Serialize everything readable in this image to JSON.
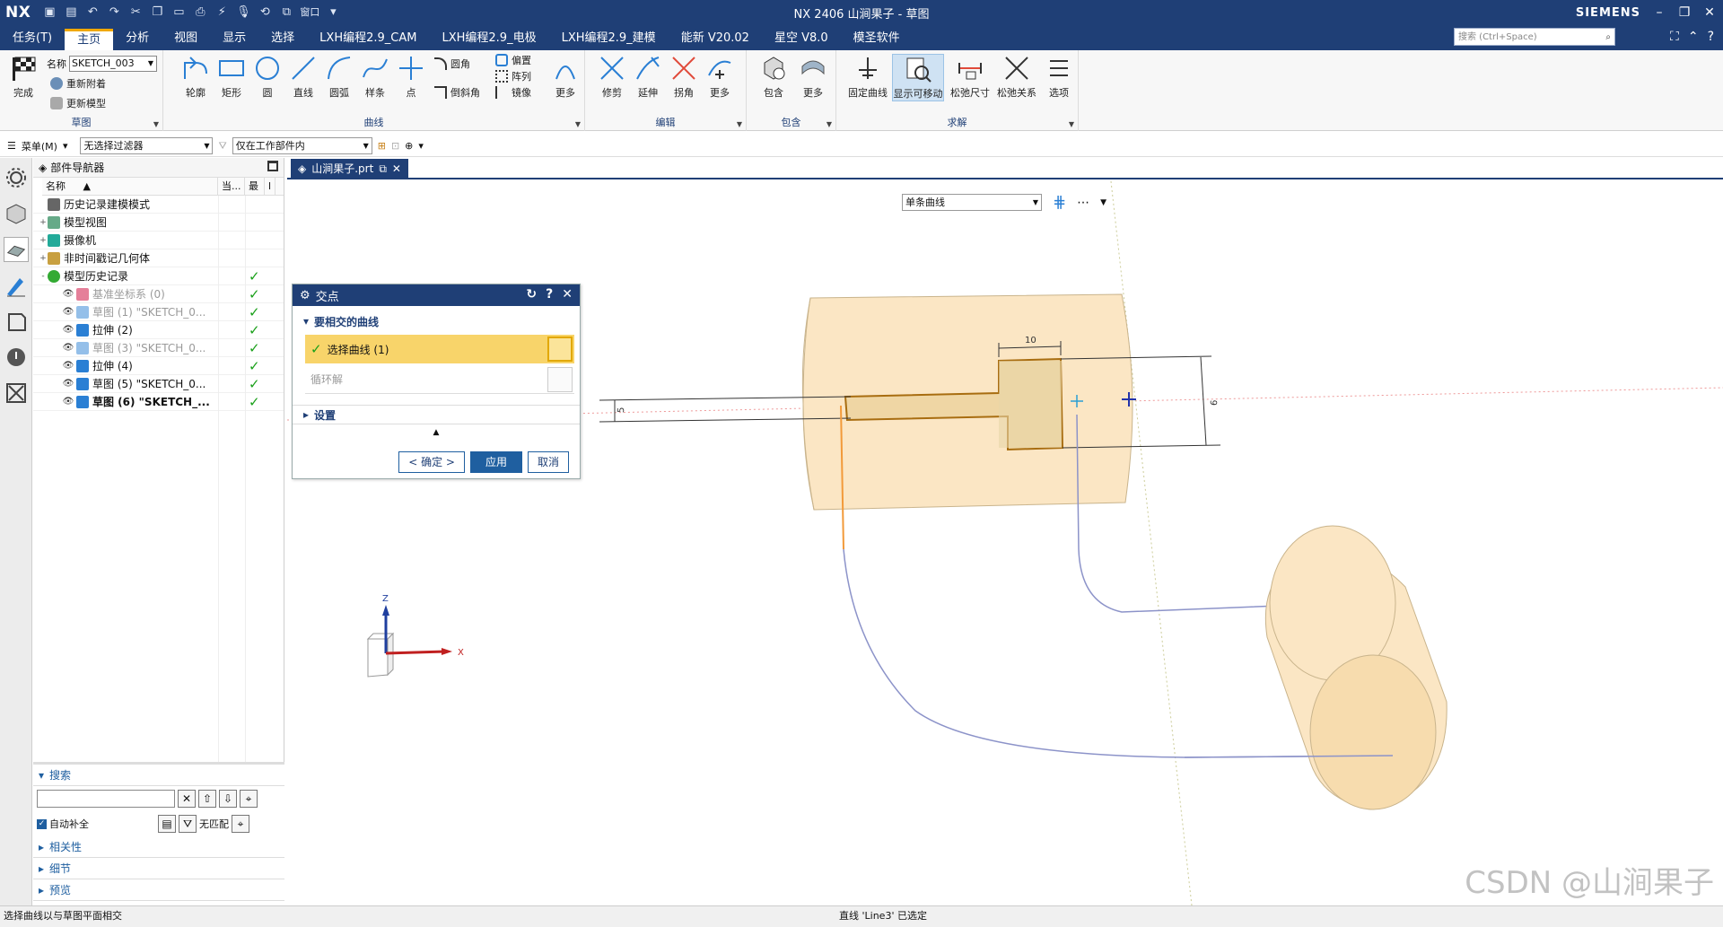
{
  "titlebar": {
    "logo": "NX",
    "title": "NX 2406 山涧果子 - 草图",
    "brand": "SIEMENS",
    "window_label": "窗口"
  },
  "menu": {
    "tabs": [
      "任务(T)",
      "主页",
      "分析",
      "视图",
      "显示",
      "选择",
      "LXH编程2.9_CAM",
      "LXH编程2.9_电极",
      "LXH编程2.9_建模",
      "能新 V20.02",
      "星空 V8.0",
      "模圣软件"
    ],
    "active_index": 1,
    "search_placeholder": "搜索 (Ctrl+Space)"
  },
  "ribbon": {
    "sketch_group": {
      "finish": "完成",
      "name_label": "名称",
      "name_value": "SKETCH_003",
      "reattach": "重新附着",
      "update_model": "更新模型",
      "label": "草图"
    },
    "curve_group": {
      "profile": "轮廓",
      "rect": "矩形",
      "circle": "圆",
      "line": "直线",
      "arc": "圆弧",
      "spline": "样条",
      "point": "点",
      "fillet": "圆角",
      "chamfer": "倒斜角",
      "offset": "偏置",
      "pattern": "阵列",
      "mirror": "镜像",
      "more": "更多",
      "label": "曲线"
    },
    "edit_group": {
      "trim": "修剪",
      "extend": "延伸",
      "corner": "拐角",
      "more": "更多",
      "label": "编辑"
    },
    "include_group": {
      "include": "包含",
      "more": "更多",
      "label": "包含"
    },
    "solve_group": {
      "fix_curve": "固定曲线",
      "show_movable": "显示可移动",
      "relax_dim": "松弛尺寸",
      "relax_rel": "松弛关系",
      "options": "选项",
      "label": "求解"
    }
  },
  "toolbar2": {
    "menu": "菜单(M)",
    "filter": "无选择过滤器",
    "scope": "仅在工作部件内"
  },
  "partnav": {
    "title": "部件导航器",
    "cols": [
      "名称",
      "当...",
      "最",
      "l"
    ],
    "rows": [
      {
        "exp": "",
        "label": "历史记录建模模式",
        "style": "",
        "chk": ""
      },
      {
        "exp": "+",
        "label": "模型视图",
        "style": "",
        "chk": ""
      },
      {
        "exp": "+",
        "label": "摄像机",
        "style": "",
        "chk": ""
      },
      {
        "exp": "+",
        "label": "非时间戳记几何体",
        "style": "",
        "chk": ""
      },
      {
        "exp": "-",
        "label": "模型历史记录",
        "style": "",
        "chk": "✓"
      },
      {
        "exp": "",
        "label": "基准坐标系 (0)",
        "style": "gray",
        "chk": "✓"
      },
      {
        "exp": "",
        "label": "草图 (1) \"SKETCH_0...",
        "style": "gray",
        "chk": "✓"
      },
      {
        "exp": "",
        "label": "拉伸 (2)",
        "style": "",
        "chk": "✓"
      },
      {
        "exp": "",
        "label": "草图 (3) \"SKETCH_0...",
        "style": "gray",
        "chk": "✓"
      },
      {
        "exp": "",
        "label": "拉伸 (4)",
        "style": "",
        "chk": "✓"
      },
      {
        "exp": "",
        "label": "草图 (5) \"SKETCH_0...",
        "style": "",
        "chk": "✓"
      },
      {
        "exp": "",
        "label": "草图 (6) \"SKETCH_...",
        "style": "bold",
        "chk": "✓"
      }
    ],
    "search": "搜索",
    "autocomplete": "自动补全",
    "no_match": "无匹配",
    "sections": [
      "相关性",
      "细节",
      "预览"
    ]
  },
  "doctab": {
    "label": "山涧果子.prt"
  },
  "topsel": {
    "value": "单条曲线"
  },
  "dialog": {
    "title": "交点",
    "group": "要相交的曲线",
    "select": "选择曲线 (1)",
    "cycle": "循环解",
    "settings": "设置",
    "ok": "< 确定 >",
    "apply": "应用",
    "cancel": "取消"
  },
  "dims": {
    "d10": "10",
    "d5": "5",
    "d6": "6"
  },
  "axes": {
    "z": "Z",
    "x": "X"
  },
  "status": {
    "left": "选择曲线以与草图平面相交",
    "center": "直线 'Line3' 已选定"
  },
  "watermark": "CSDN @山涧果子",
  "colors": {
    "title_blue": "#1f3f76",
    "body_fill": "#fbe6c4",
    "selected": "#f8d46a",
    "curve_blue": "#8c93c9",
    "sketch_brown": "#a86d10"
  }
}
